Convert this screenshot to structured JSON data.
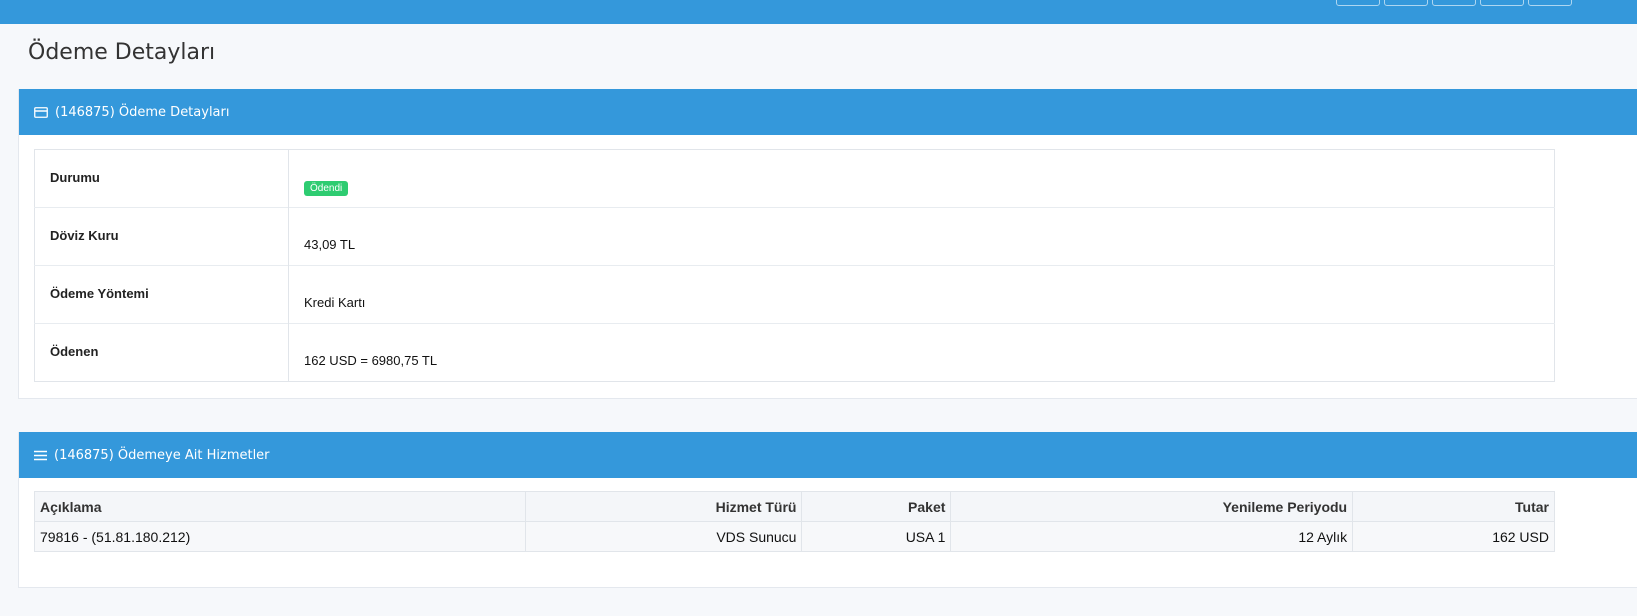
{
  "page": {
    "title": "Ödeme Detayları"
  },
  "payment_panel": {
    "title": "(146875) Ödeme Detayları",
    "icon": "credit-card-icon",
    "rows": [
      {
        "label": "Durumu",
        "value": "Ödendi"
      },
      {
        "label": "Döviz Kuru",
        "value": "43,09 TL"
      },
      {
        "label": "Ödeme Yöntemi",
        "value": "Kredi Kartı"
      },
      {
        "label": "Ödenen",
        "value": "162 USD = 6980,75 TL"
      }
    ],
    "status_color": "#2ecc71"
  },
  "services_panel": {
    "title": "(146875) Ödemeye Ait Hizmetler",
    "icon": "list-icon",
    "columns": [
      "Açıklama",
      "Hizmet Türü",
      "Paket",
      "Yenileme Periyodu",
      "Tutar"
    ],
    "rows": [
      [
        "79816 - (51.81.180.212)",
        "VDS Sunucu",
        "USA 1",
        "12 Aylık",
        "162 USD"
      ]
    ]
  },
  "colors": {
    "accent": "#3498db",
    "success": "#2ecc71"
  }
}
